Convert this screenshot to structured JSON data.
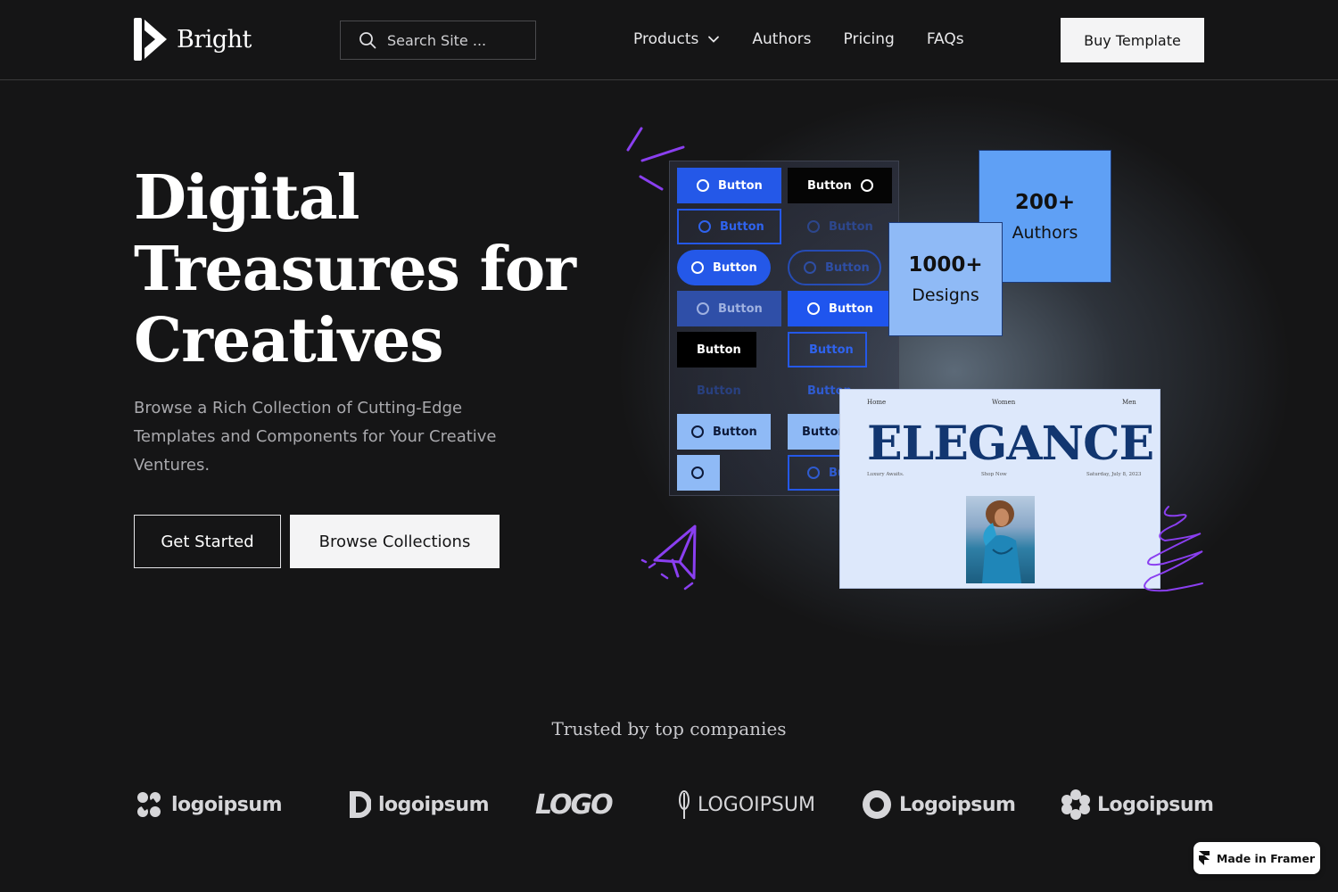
{
  "header": {
    "brand": "Bright",
    "search_placeholder": "Search Site ...",
    "nav": [
      "Products",
      "Authors",
      "Pricing",
      "FAQs"
    ],
    "buy_label": "Buy Template"
  },
  "hero": {
    "title": "Digital Treasures for Creatives",
    "subtitle": "Browse a Rich Collection of Cutting-Edge Templates and Components for Your Creative Ventures.",
    "primary_cta": "Get Started",
    "secondary_cta": "Browse Collections"
  },
  "illustration": {
    "button_label": "Button",
    "stats": [
      {
        "value": "200+",
        "label": "Authors"
      },
      {
        "value": "1000+",
        "label": "Designs"
      }
    ],
    "card": {
      "nav": [
        "Home",
        "Women",
        "Men"
      ],
      "title": "ELEGANCE",
      "tagline": "Luxury Awaits.",
      "link": "Shop Now",
      "date": "Saturday, July 8, 2023"
    },
    "accent": "#8a3ff0",
    "blue": "#2458e8",
    "light_blue": "#5fa0f5"
  },
  "trusted": {
    "heading": "Trusted by top companies",
    "logos": [
      "logoipsum",
      "logoipsum",
      "LOGO",
      "LOGOIPSUM",
      "Logoipsum",
      "Logoipsum"
    ]
  },
  "badge": {
    "label": "Made in Framer"
  }
}
